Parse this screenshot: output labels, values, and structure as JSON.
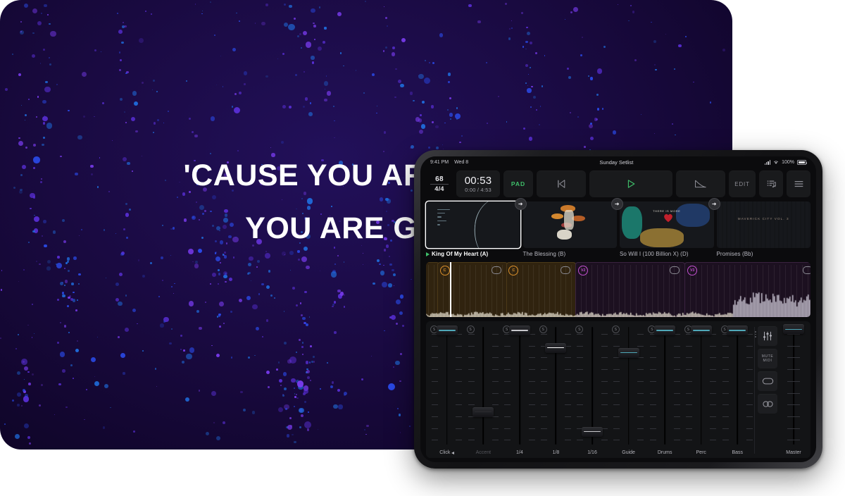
{
  "background": {
    "lyrics": [
      "'CAUSE YOU ARE GOOD",
      "YOU ARE GOOD"
    ],
    "bg_color": "#1b0b45",
    "particle_colors": [
      "#7a3cf0",
      "#5a2fd8",
      "#2b4df0",
      "#1f6fe0"
    ]
  },
  "tablet": {
    "statusbar": {
      "time": "9:41 PM",
      "date": "Wed 8",
      "title": "Sunday Setlist",
      "battery_percent": "100%",
      "signal_icon": "cellular-signal-icon",
      "wifi_icon": "wifi-icon",
      "battery_icon": "battery-icon"
    },
    "transport": {
      "bpm": "68",
      "time_signature": "4/4",
      "elapsed": "00:53",
      "position": "0:00 / 4:53",
      "pad_label": "PAD",
      "pad_color": "#3fbf6a",
      "restart_icon": "skip-to-start-icon",
      "play_icon": "play-icon",
      "play_color": "#3fbf6a",
      "fade_icon": "fade-out-icon",
      "edit_label": "EDIT",
      "setlist_icon": "setlist-icon",
      "menu_icon": "hamburger-menu-icon",
      "next_song_icon": "next-song-arrow-icon"
    },
    "songs": [
      {
        "title": "King Of My Heart (A)",
        "selected": true,
        "playing": true
      },
      {
        "title": "The Blessing (B)",
        "selected": false,
        "playing": false
      },
      {
        "title": "So Will I (100 Billion X) (D)",
        "selected": false,
        "playing": false
      },
      {
        "title": "Promises (Bb)",
        "selected": false,
        "playing": false
      }
    ],
    "album_art_text": {
      "art3_title": "THERE IS MORE",
      "art4_title": "MAVERICK CITY VOL. 3"
    },
    "waveform": {
      "markers": [
        {
          "label": "C",
          "type": "chorus",
          "color": "#d98f2b",
          "left_pct": 3.6
        },
        {
          "label": "C",
          "type": "chorus",
          "color": "#d98f2b",
          "left_pct": 21.5
        },
        {
          "label": "V2",
          "type": "verse",
          "color": "#c24fd0",
          "left_pct": 39.6
        },
        {
          "label": "V3",
          "type": "verse",
          "color": "#c24fd0",
          "left_pct": 68.0
        }
      ],
      "loop_icons_pct": [
        17.0,
        34.9,
        63.4,
        98.0
      ],
      "playhead_pct": 6.3,
      "segments": [
        {
          "tone": "amber",
          "left_pct": -1.0,
          "width_pct": 4.4
        },
        {
          "tone": "amber",
          "left_pct": 3.0,
          "width_pct": 18.2
        },
        {
          "tone": "amber",
          "left_pct": 20.9,
          "width_pct": 18.2
        },
        {
          "tone": "plum",
          "left_pct": 38.8,
          "width_pct": 28.6
        },
        {
          "tone": "plum",
          "left_pct": 67.2,
          "width_pct": 33.5
        }
      ]
    },
    "mixer": {
      "channels": [
        {
          "name": "Click",
          "value_pct": 96,
          "line_color": "#4fa8b8",
          "dim": false,
          "speaker_icon": true,
          "solo": true
        },
        {
          "name": "Accent",
          "value_pct": 30,
          "line_color": "#2a2b2f",
          "dim": true,
          "speaker_icon": false,
          "solo": true
        },
        {
          "name": "1/4",
          "value_pct": 96,
          "line_color": "#c8c8cc",
          "dim": false,
          "speaker_icon": false,
          "solo": true
        },
        {
          "name": "1/8",
          "value_pct": 82,
          "line_color": "#ffffff",
          "dim": false,
          "speaker_icon": false,
          "solo": true
        },
        {
          "name": "1/16",
          "value_pct": 14,
          "line_color": "#c8c8cc",
          "dim": false,
          "speaker_icon": false,
          "solo": true
        },
        {
          "name": "Guide",
          "value_pct": 78,
          "line_color": "#4fa8b8",
          "dim": false,
          "speaker_icon": false,
          "solo": true
        },
        {
          "name": "Drums",
          "value_pct": 96,
          "line_color": "#4fa8b8",
          "dim": false,
          "speaker_icon": false,
          "solo": true
        },
        {
          "name": "Perc",
          "value_pct": 96,
          "line_color": "#4fa8b8",
          "dim": false,
          "speaker_icon": false,
          "solo": true
        },
        {
          "name": "Bass",
          "value_pct": 96,
          "line_color": "#4fa8b8",
          "dim": false,
          "speaker_icon": false,
          "solo": true
        }
      ],
      "master": {
        "name": "Master",
        "value_pct": 97,
        "line_color": "#4fa8b8"
      },
      "util": {
        "eq_icon": "mixer-sliders-icon",
        "mute_midi_line1": "MUTE",
        "mute_midi_line2": "MIDI",
        "loop_icon": "loop-icon",
        "link_icon": "link-icon"
      }
    }
  }
}
